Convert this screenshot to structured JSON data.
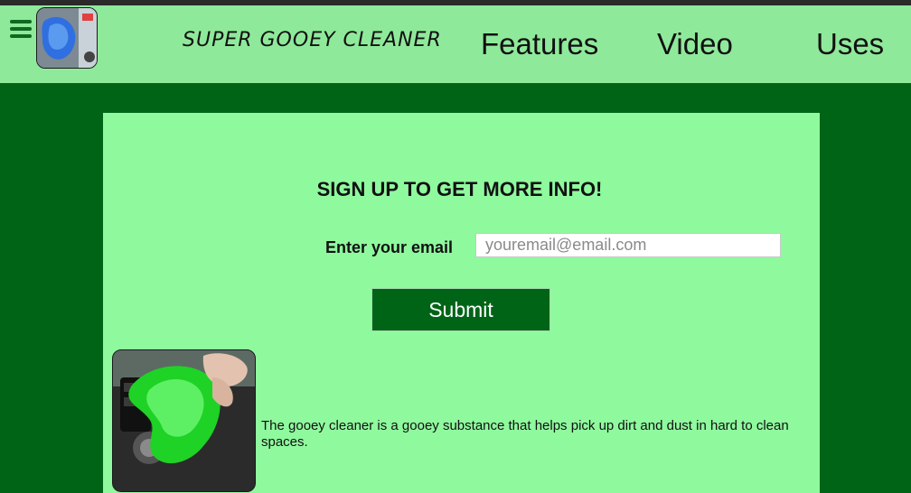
{
  "header": {
    "brand": "SUPER GOOEY CLEANER",
    "nav": [
      "Features",
      "Video",
      "Uses"
    ],
    "menu_icon": "hamburger-menu-icon",
    "logo_icon": "gooey-cleaner-logo"
  },
  "signup": {
    "heading": "SIGN UP TO GET MORE INFO!",
    "email_label": "Enter your email",
    "email_placeholder": "youremail@email.com",
    "email_value": "",
    "submit_label": "Submit"
  },
  "content": {
    "description": "The gooey cleaner is a gooey substance that helps pick up dirt and dust in hard to clean spaces.",
    "image_icon": "gooey-cleaner-in-car-photo"
  },
  "colors": {
    "background": "#006417",
    "header": "#8fe99a",
    "panel": "#8ff99e",
    "button": "#006417"
  }
}
